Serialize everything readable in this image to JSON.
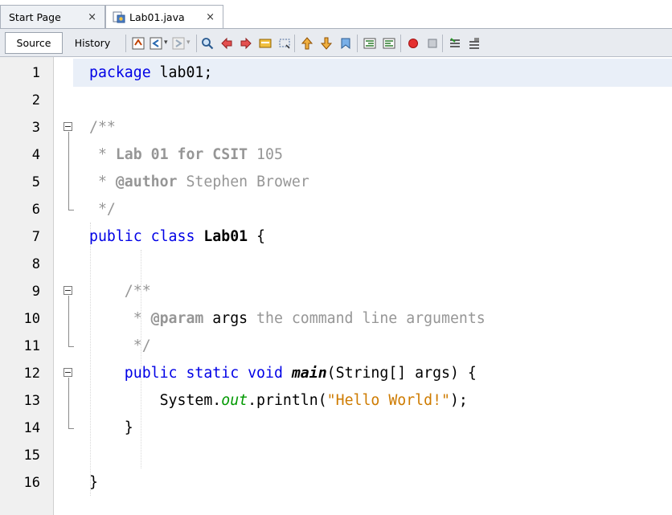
{
  "tabs": [
    {
      "label": "Start Page",
      "close": "×"
    },
    {
      "label": "Lab01.java",
      "close": "×"
    }
  ],
  "toolbar": {
    "source_label": "Source",
    "history_label": "History"
  },
  "editor": {
    "line_numbers": [
      "1",
      "2",
      "3",
      "4",
      "5",
      "6",
      "7",
      "8",
      "9",
      "10",
      "11",
      "12",
      "13",
      "14",
      "15",
      "16"
    ],
    "lines": [
      [
        {
          "t": "package lab01;",
          "c": "kw-mix"
        }
      ],
      [],
      [
        {
          "t": "/**",
          "c": "cm"
        }
      ],
      [
        {
          "t": " * ",
          "c": "cm"
        },
        {
          "t": "Lab 01 for CSIT",
          "c": "cmb"
        },
        {
          "t": " 105",
          "c": "cm"
        }
      ],
      [
        {
          "t": " * ",
          "c": "cm"
        },
        {
          "t": "@author",
          "c": "cmb"
        },
        {
          "t": " Stephen Brower",
          "c": "cm"
        }
      ],
      [
        {
          "t": " */",
          "c": "cm"
        }
      ],
      [
        {
          "t": "public class ",
          "c": "kw"
        },
        {
          "t": "Lab01",
          "c": "bld"
        },
        {
          "t": " {",
          "c": ""
        }
      ],
      [],
      [
        {
          "t": "    /**",
          "c": "cm"
        }
      ],
      [
        {
          "t": "     * ",
          "c": "cm"
        },
        {
          "t": "@param",
          "c": "cmb"
        },
        {
          "t": " args",
          "c": ""
        },
        {
          "t": " the command line arguments",
          "c": "cm"
        }
      ],
      [
        {
          "t": "     */",
          "c": "cm"
        }
      ],
      [
        {
          "t": "    public static void ",
          "c": "kw"
        },
        {
          "t": "main",
          "c": "bi"
        },
        {
          "t": "(String[] args) {",
          "c": ""
        }
      ],
      [
        {
          "t": "        System.",
          "c": ""
        },
        {
          "t": "out",
          "c": "fld"
        },
        {
          "t": ".println(",
          "c": ""
        },
        {
          "t": "\"Hello World!\"",
          "c": "str"
        },
        {
          "t": ");",
          "c": ""
        }
      ],
      [
        {
          "t": "    }",
          "c": ""
        }
      ],
      [],
      [
        {
          "t": "}",
          "c": ""
        }
      ]
    ]
  }
}
